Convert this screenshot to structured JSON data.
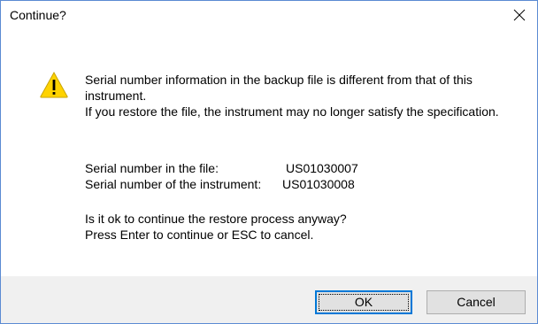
{
  "window": {
    "title": "Continue?"
  },
  "message": {
    "line1": "Serial number information in the backup file is different from that of this instrument.",
    "line2": "If you restore the file, the instrument may no longer satisfy the specification."
  },
  "serials": {
    "file_label": "Serial number in the file:",
    "file_value": "US01030007",
    "instrument_label": "Serial number of the instrument:",
    "instrument_value": "US01030008"
  },
  "question": {
    "line1": "Is it ok to continue the restore process anyway?",
    "line2": "Press Enter to continue or ESC to cancel."
  },
  "buttons": {
    "ok_label": "OK",
    "cancel_label": "Cancel"
  },
  "icons": {
    "warning": "warning-icon",
    "close": "close-icon"
  },
  "colors": {
    "warning_fill": "#ffd300",
    "focus_border": "#0078d7",
    "window_border": "#5b8bd3"
  }
}
